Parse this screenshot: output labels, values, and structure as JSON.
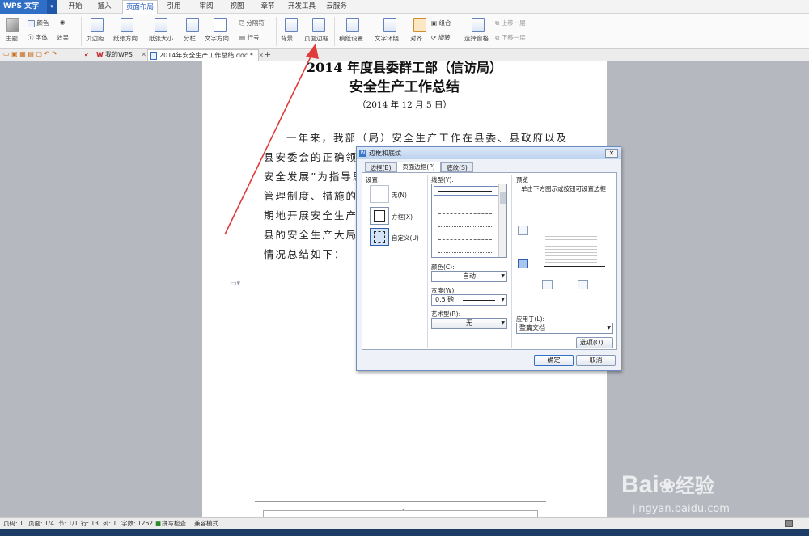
{
  "app": {
    "logo": "WPS 文字",
    "dropdown": "▾"
  },
  "ribbon_tabs": [
    "开始",
    "插入",
    "页面布局",
    "引用",
    "审阅",
    "视图",
    "章节",
    "开发工具",
    "云服务"
  ],
  "active_tab": "页面布局",
  "ribbon": {
    "theme": "主题",
    "color": "颜色",
    "font": "字体",
    "effect": "效果",
    "margins": "页边距",
    "orientation": "纸张方向",
    "size": "纸张大小",
    "columns": "分栏",
    "text_direction": "文字方向",
    "separator": "分隔符",
    "line_number": "行号",
    "background": "背景",
    "page_border": "页面边框",
    "paper_setup": "稿纸设置",
    "wrap": "文字环绕",
    "align": "对齐",
    "group": "组合",
    "rotate": "旋转",
    "select_pane": "选择窗格",
    "bring_forward": "上移一层",
    "send_backward": "下移一层"
  },
  "doc_tabs": {
    "home": "我的WPS",
    "doc": "2014年安全生产工作总结.doc *",
    "add": "+"
  },
  "document": {
    "title1": "2014 年度县委群工部（信访局）",
    "title2": "安全生产工作总结",
    "date": "（2014 年 12 月 5 日）",
    "lines": [
      "一年来，我部（局）安全生产工作在县委、县政府以及",
      "县安委会的正确领导",
      "安全发展”为指导思",
      "管理制度、措施的落",
      "期地开展安全生产大",
      "县的安全生产大局作",
      "情况总结如下："
    ],
    "page_marker": "1"
  },
  "status": {
    "page_no": "页码: 1",
    "pages": "页面: 1/4",
    "section": "节: 1/1",
    "row": "行: 13",
    "col": "列: 1",
    "chars": "字数: 1262",
    "spell": "拼写检查",
    "compat": "兼容模式"
  },
  "dialog": {
    "title": "边框和底纹",
    "tabs": [
      "边框(B)",
      "页面边框(P)",
      "底纹(S)"
    ],
    "settings_label": "设置:",
    "setting_none": "无(N)",
    "setting_box": "方框(X)",
    "setting_custom": "自定义(U)",
    "style_label": "线型(Y):",
    "color_label": "颜色(C):",
    "color_value": "自动",
    "width_label": "宽度(W):",
    "width_value": "0.5  磅",
    "art_label": "艺术型(R):",
    "art_value": "无",
    "preview_label": "预览",
    "preview_hint": "单击下方图示或按钮可设置边框",
    "apply_label": "应用于(L):",
    "apply_value": "整篇文档",
    "options_btn": "选项(O)...",
    "ok": "确定",
    "cancel": "取消"
  },
  "watermark": {
    "brand": "Bai",
    "brand2": "经验",
    "site": "jingyan.baidu.com"
  },
  "colors": {
    "accent": "#2f6fc6",
    "arrow": "#e03a3a",
    "dialog_border": "#6a8cc0"
  }
}
